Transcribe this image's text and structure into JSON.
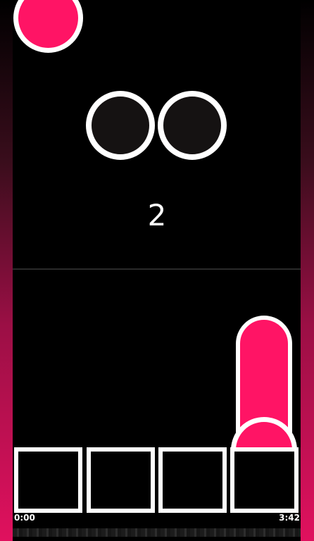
{
  "game": {
    "score": "2",
    "time_elapsed": "0:00",
    "time_total": "3:42",
    "progress": 0
  },
  "colors": {
    "accent": "#ff1465",
    "note_border": "#ffffff",
    "background": "#000000",
    "hole_fill": "#151212"
  },
  "lanes": [
    {
      "id": 1
    },
    {
      "id": 2
    },
    {
      "id": 3
    },
    {
      "id": 4
    }
  ]
}
